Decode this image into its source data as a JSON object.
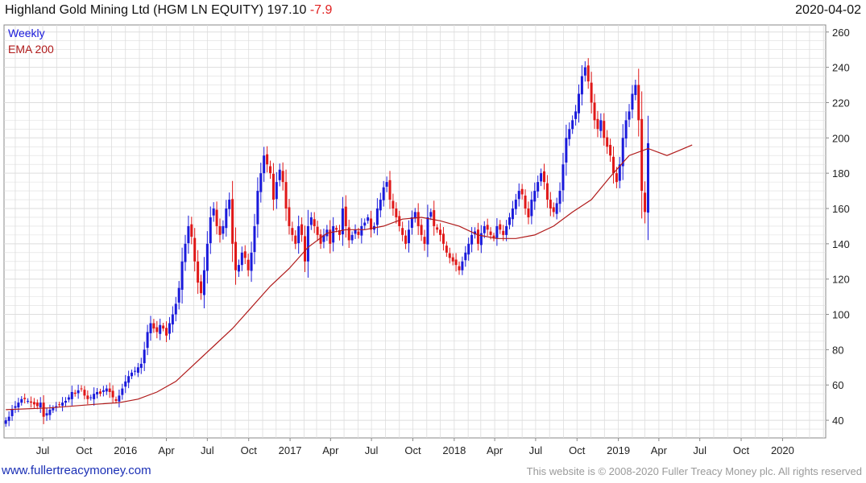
{
  "header": {
    "title": "Highland Gold Mining Ltd (HGM LN EQUITY)",
    "last_price": "197.10",
    "change": "-7.9",
    "date": "2020-04-02"
  },
  "footer": {
    "website": "www.fullertreacymoney.com",
    "copyright": "This website is © 2008-2020 Fuller Treacy Money plc. All rights reserved"
  },
  "colors": {
    "up": "#1a1adb",
    "down": "#e01818",
    "ema": "#b01a1a",
    "grid": "#dddddd",
    "axis": "#888888"
  },
  "chart_data": {
    "type": "candlestick",
    "legend": [
      {
        "label": "Weekly",
        "color": "#1a1adb"
      },
      {
        "label": "EMA 200",
        "color": "#b01a1a"
      }
    ],
    "legend_position": "top-left",
    "grid": true,
    "y_axis_side": "right",
    "ylim": [
      30,
      264
    ],
    "y_ticks": [
      40,
      60,
      80,
      100,
      120,
      140,
      160,
      180,
      200,
      220,
      240,
      260
    ],
    "x_range": [
      "2015-04-06",
      "2020-04-06"
    ],
    "x_ticks": [
      {
        "date": "2015-07-01",
        "label": "Jul"
      },
      {
        "date": "2015-10-01",
        "label": "Oct"
      },
      {
        "date": "2016-01-01",
        "label": "2016"
      },
      {
        "date": "2016-04-01",
        "label": "Apr"
      },
      {
        "date": "2016-07-01",
        "label": "Jul"
      },
      {
        "date": "2016-10-01",
        "label": "Oct"
      },
      {
        "date": "2017-01-01",
        "label": "2017"
      },
      {
        "date": "2017-04-01",
        "label": "Apr"
      },
      {
        "date": "2017-07-01",
        "label": "Jul"
      },
      {
        "date": "2017-10-01",
        "label": "Oct"
      },
      {
        "date": "2018-01-01",
        "label": "2018"
      },
      {
        "date": "2018-04-01",
        "label": "Apr"
      },
      {
        "date": "2018-07-01",
        "label": "Jul"
      },
      {
        "date": "2018-10-01",
        "label": "Oct"
      },
      {
        "date": "2019-01-01",
        "label": "2019"
      },
      {
        "date": "2019-04-01",
        "label": "Apr"
      },
      {
        "date": "2019-07-01",
        "label": "Jul"
      },
      {
        "date": "2019-10-01",
        "label": "Oct"
      },
      {
        "date": "2020-01-01",
        "label": "2020"
      }
    ],
    "weekly_close": {
      "start": "2015-04-10",
      "values": [
        40,
        42,
        46,
        48,
        50,
        52,
        52,
        51,
        50,
        49,
        48,
        50,
        42,
        44,
        46,
        47,
        48,
        49,
        50,
        51,
        53,
        56,
        55,
        57,
        58,
        54,
        52,
        53,
        55,
        56,
        55,
        57,
        58,
        56,
        53,
        51,
        54,
        58,
        62,
        65,
        67,
        68,
        70,
        72,
        80,
        90,
        95,
        92,
        90,
        94,
        92,
        88,
        95,
        100,
        106,
        115,
        130,
        140,
        150,
        144,
        130,
        118,
        112,
        125,
        140,
        155,
        160,
        150,
        145,
        150,
        160,
        165,
        140,
        125,
        128,
        135,
        132,
        125,
        135,
        150,
        170,
        180,
        190,
        185,
        180,
        165,
        175,
        182,
        175,
        160,
        150,
        145,
        140,
        150,
        145,
        130,
        150,
        155,
        150,
        145,
        140,
        145,
        148,
        140,
        150,
        148,
        145,
        160,
        150,
        142,
        145,
        148,
        145,
        150,
        152,
        155,
        148,
        150,
        160,
        165,
        172,
        175,
        165,
        160,
        155,
        150,
        145,
        140,
        148,
        155,
        158,
        150,
        145,
        140,
        155,
        158,
        150,
        148,
        145,
        140,
        135,
        132,
        130,
        128,
        125,
        130,
        135,
        140,
        145,
        147,
        140,
        146,
        150,
        148,
        145,
        143,
        150,
        148,
        145,
        150,
        155,
        160,
        165,
        170,
        168,
        160,
        155,
        165,
        170,
        175,
        180,
        175,
        165,
        160,
        158,
        163,
        170,
        185,
        200,
        205,
        210,
        215,
        225,
        235,
        240,
        232,
        220,
        210,
        205,
        210,
        200,
        195,
        190,
        180,
        175,
        185,
        200,
        210,
        215,
        225,
        230,
        210,
        170,
        158,
        197
      ]
    },
    "ema_200": {
      "start": "2015-04-10",
      "points": [
        [
          0,
          46
        ],
        [
          14,
          47
        ],
        [
          28,
          49
        ],
        [
          36,
          50
        ],
        [
          42,
          52
        ],
        [
          48,
          56
        ],
        [
          54,
          62
        ],
        [
          60,
          72
        ],
        [
          66,
          82
        ],
        [
          72,
          92
        ],
        [
          78,
          104
        ],
        [
          84,
          116
        ],
        [
          90,
          126
        ],
        [
          96,
          138
        ],
        [
          102,
          146
        ],
        [
          108,
          148
        ],
        [
          114,
          148
        ],
        [
          120,
          150
        ],
        [
          126,
          154
        ],
        [
          132,
          155
        ],
        [
          138,
          153
        ],
        [
          144,
          150
        ],
        [
          150,
          145
        ],
        [
          156,
          143
        ],
        [
          162,
          143
        ],
        [
          168,
          145
        ],
        [
          174,
          150
        ],
        [
          180,
          158
        ],
        [
          186,
          165
        ],
        [
          192,
          178
        ],
        [
          198,
          190
        ],
        [
          204,
          194
        ],
        [
          210,
          190
        ],
        [
          214,
          193
        ],
        [
          218,
          196
        ]
      ]
    }
  }
}
